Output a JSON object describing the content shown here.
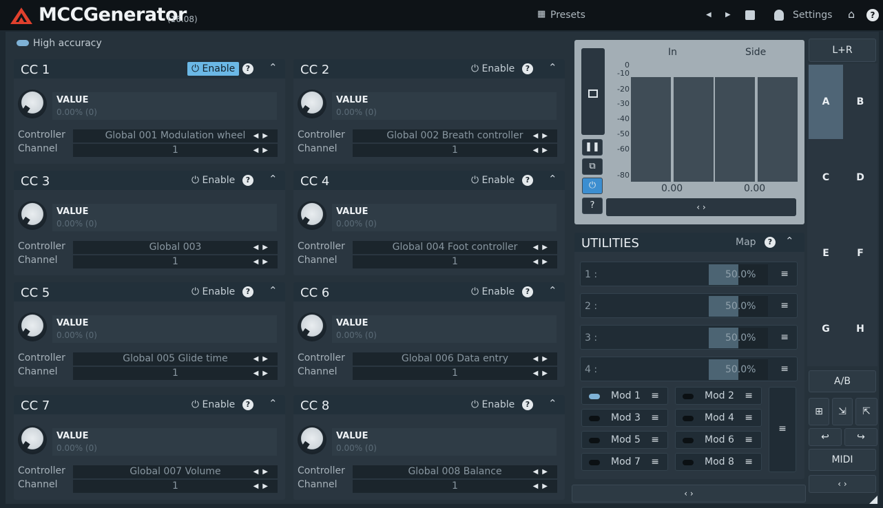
{
  "app": {
    "title": "MCCGenerator",
    "version": "(16.08)",
    "presets": "Presets",
    "settings": "Settings"
  },
  "options": {
    "high_accuracy": "High accuracy"
  },
  "cc_common": {
    "enable": "Enable",
    "value_label": "VALUE",
    "value": "0.00% (0)",
    "controller_label": "Controller",
    "channel_label": "Channel"
  },
  "cc": [
    {
      "title": "CC 1",
      "controller": "Global 001 Modulation wheel",
      "channel": "1",
      "enabled": true
    },
    {
      "title": "CC 2",
      "controller": "Global 002 Breath controller",
      "channel": "1",
      "enabled": false
    },
    {
      "title": "CC 3",
      "controller": "Global 003",
      "channel": "1",
      "enabled": false
    },
    {
      "title": "CC 4",
      "controller": "Global 004 Foot controller",
      "channel": "1",
      "enabled": false
    },
    {
      "title": "CC 5",
      "controller": "Global 005 Glide time",
      "channel": "1",
      "enabled": false
    },
    {
      "title": "CC 6",
      "controller": "Global 006 Data entry",
      "channel": "1",
      "enabled": false
    },
    {
      "title": "CC 7",
      "controller": "Global 007 Volume",
      "channel": "1",
      "enabled": false
    },
    {
      "title": "CC 8",
      "controller": "Global 008 Balance",
      "channel": "1",
      "enabled": false
    }
  ],
  "meter": {
    "in_label": "In",
    "side_label": "Side",
    "scale": [
      "0",
      "-10",
      "-20",
      "-30",
      "-40",
      "-50",
      "-60",
      "-80"
    ],
    "in_value": "0.00",
    "side_value": "0.00",
    "expand": "‹ ›"
  },
  "utilities": {
    "title": "UTILITIES",
    "map": "Map",
    "rows": [
      {
        "num": "1 :",
        "value": "50.0%",
        "fill": 0.5
      },
      {
        "num": "2 :",
        "value": "50.0%",
        "fill": 0.5
      },
      {
        "num": "3 :",
        "value": "50.0%",
        "fill": 0.5
      },
      {
        "num": "4 :",
        "value": "50.0%",
        "fill": 0.5
      }
    ],
    "mods": [
      {
        "label": "Mod 1",
        "on": true
      },
      {
        "label": "Mod 2",
        "on": false
      },
      {
        "label": "Mod 3",
        "on": false
      },
      {
        "label": "Mod 4",
        "on": false
      },
      {
        "label": "Mod 5",
        "on": false
      },
      {
        "label": "Mod 6",
        "on": false
      },
      {
        "label": "Mod 7",
        "on": false
      },
      {
        "label": "Mod 8",
        "on": false
      }
    ],
    "expand": "‹ ›"
  },
  "presets_panel": {
    "lr": "L+R",
    "slots": [
      "A",
      "B",
      "C",
      "D",
      "E",
      "F",
      "G",
      "H"
    ],
    "ab": "A/B",
    "midi": "MIDI",
    "expand": "‹ ›"
  },
  "colors": {
    "accent": "#6bb8e6",
    "bg": "#26323b"
  }
}
